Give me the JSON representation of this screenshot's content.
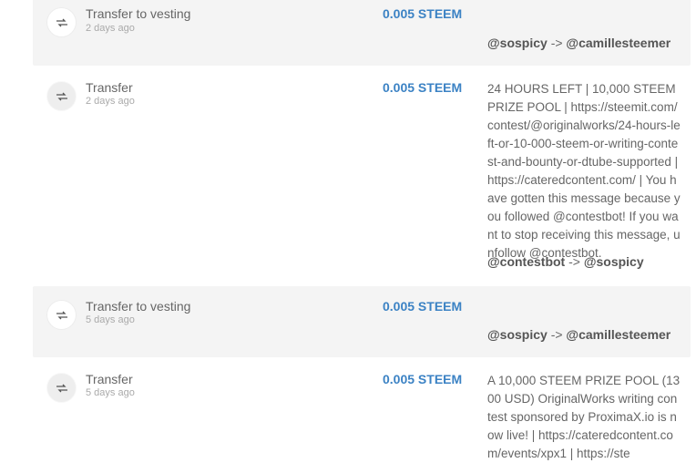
{
  "transactions": [
    {
      "type": "Transfer to vesting",
      "date": "2 days ago",
      "amount": "0.005 STEEM",
      "memo": "",
      "from": "@sospicy",
      "arrow": "->",
      "to": "@camillesteemer"
    },
    {
      "type": "Transfer",
      "date": "2 days ago",
      "amount": "0.005 STEEM",
      "memo": "24 HOURS LEFT | 10,000 STEEM PRIZE POOL | https://steemit.com/contest/@originalworks/24-hours-left-or-10-000-steem-or-writing-contest-and-bounty-or-dtube-supported | https://cateredcontent.com/ | You have gotten this message because you followed @contestbot! If you want to stop receiving this message, unfollow @contestbot.",
      "from": "@contestbot",
      "arrow": "->",
      "to": "@sospicy"
    },
    {
      "type": "Transfer to vesting",
      "date": "5 days ago",
      "amount": "0.005 STEEM",
      "memo": "",
      "from": "@sospicy",
      "arrow": "->",
      "to": "@camillesteemer"
    },
    {
      "type": "Transfer",
      "date": "5 days ago",
      "amount": "0.005 STEEM",
      "memo": "A 10,000 STEEM PRIZE POOL (1300 USD) OriginalWorks writing contest sponsored by ProximaX.io is now live! | https://cateredcontent.com/events/xpx1 | https://ste",
      "from": "",
      "arrow": "",
      "to": ""
    }
  ],
  "icons": {
    "transfer": "transfer-arrows-icon"
  },
  "colors": {
    "amount": "#3b82c4",
    "shaded_row": "#f4f4f4",
    "muted": "#aaaaaa"
  }
}
